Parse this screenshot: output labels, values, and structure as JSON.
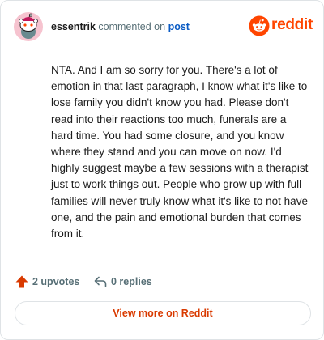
{
  "header": {
    "author": "essentrik",
    "action_text": "commented on",
    "post_link": "post",
    "brand": "reddit"
  },
  "comment": {
    "text": "NTA. And I am so sorry for you. There's a lot of emotion in that last paragraph, I know what it's like to lose family you didn't know you had. Please don't read into their reactions too much, funerals are a hard time. You had some closure, and you know where they stand and you can move on now. I'd highly suggest maybe a few sessions with a therapist just to work things out. People who grow up with full families will never truly know what it's like to not have one, and the pain and emotional burden that comes from it."
  },
  "actions": {
    "upvotes": "2 upvotes",
    "replies": "0 replies"
  },
  "footer": {
    "view_more": "View more on Reddit"
  },
  "colors": {
    "brand_orange": "#ff4500",
    "link_blue": "#0a5bc4",
    "button_text": "#d93a00",
    "avatar_bg": "#f6c3cf"
  },
  "icons": [
    "snoo-avatar-icon",
    "reddit-logo-icon",
    "upvote-arrow-icon",
    "reply-arrow-icon"
  ]
}
